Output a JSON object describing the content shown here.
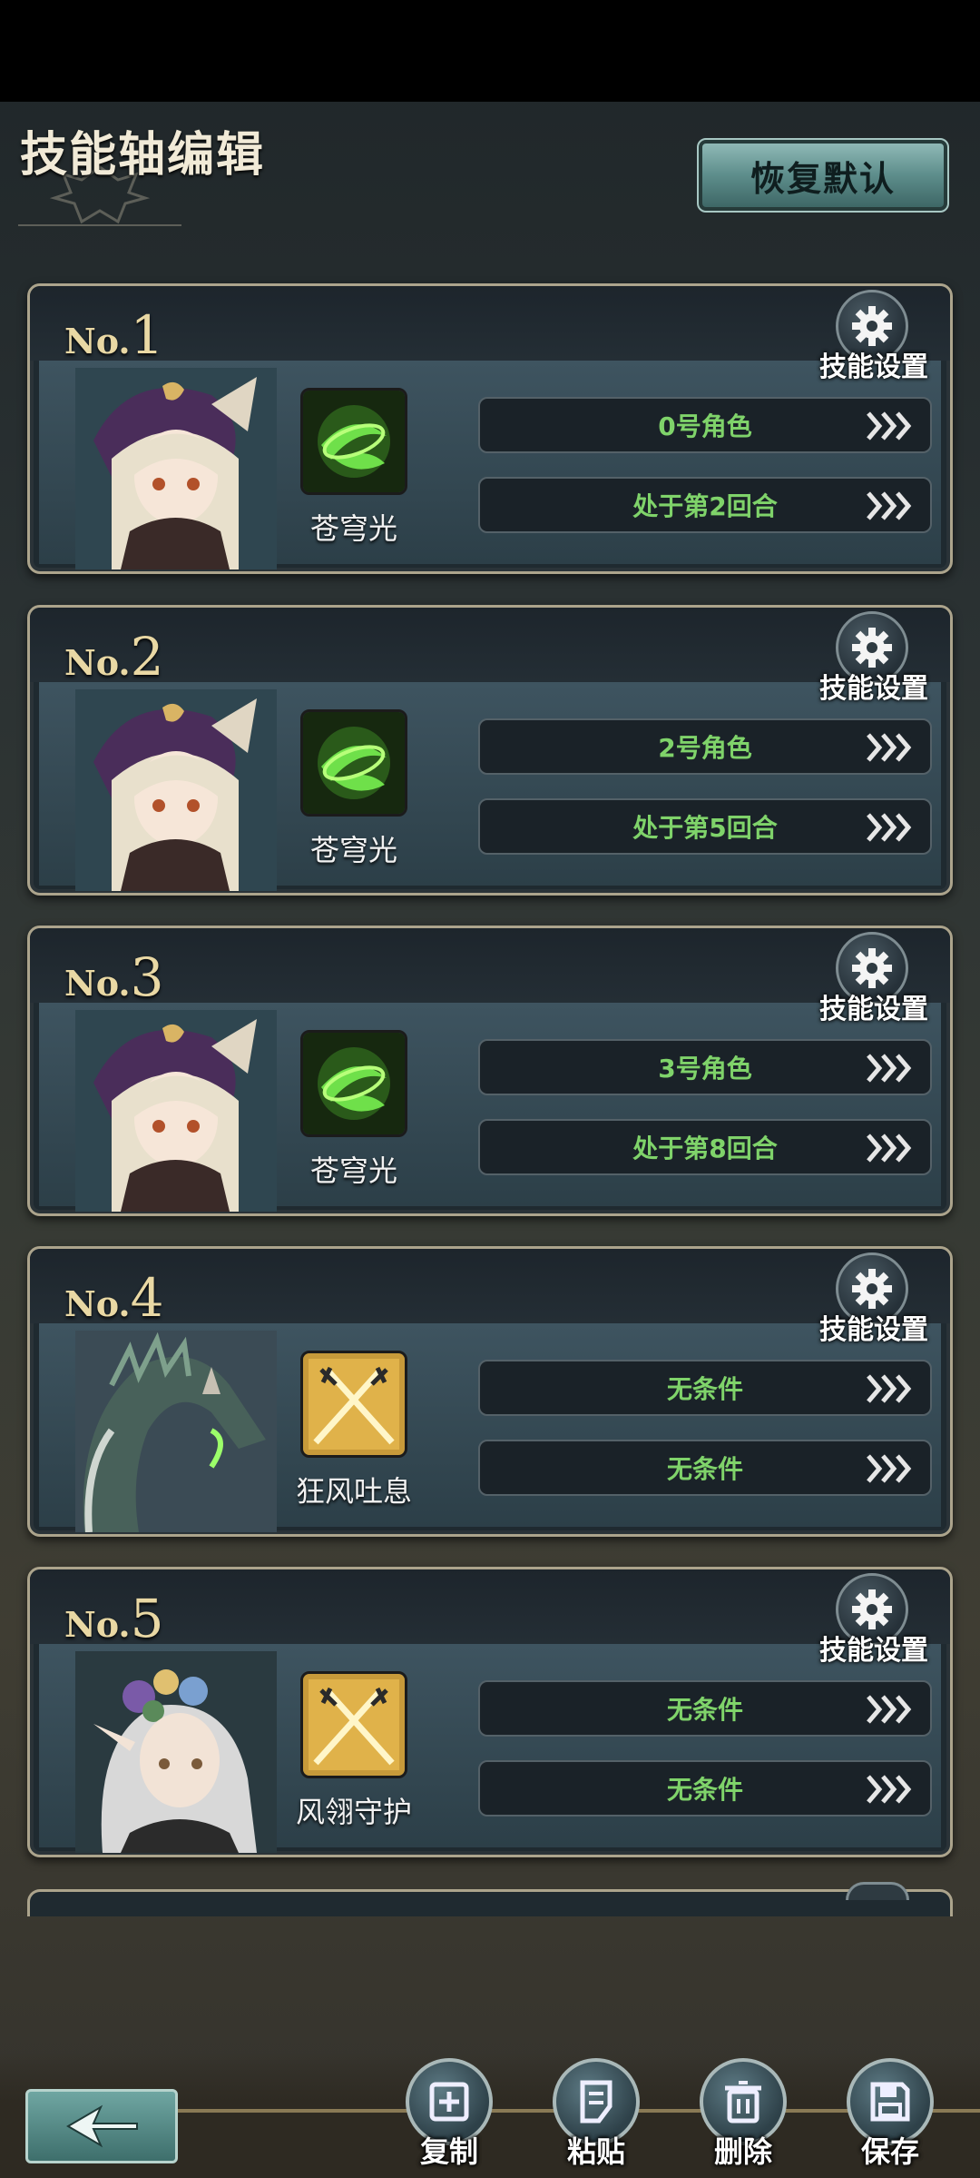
{
  "header": {
    "title": "技能轴编辑",
    "restore_label": "恢复默认"
  },
  "colors": {
    "condition_text": "#7fd36a",
    "number": "#e9d8a4",
    "accent_teal": "#5d8d8b"
  },
  "cards": [
    {
      "prefix": "No.",
      "number": "1",
      "settings_label": "技能设置",
      "skill": "苍穹光",
      "skill_type": "green",
      "portrait": "girl",
      "conditions": [
        "0号角色",
        "处于第2回合"
      ]
    },
    {
      "prefix": "No.",
      "number": "2",
      "settings_label": "技能设置",
      "skill": "苍穹光",
      "skill_type": "green",
      "portrait": "girl",
      "conditions": [
        "2号角色",
        "处于第5回合"
      ]
    },
    {
      "prefix": "No.",
      "number": "3",
      "settings_label": "技能设置",
      "skill": "苍穹光",
      "skill_type": "green",
      "portrait": "girl",
      "conditions": [
        "3号角色",
        "处于第8回合"
      ]
    },
    {
      "prefix": "No.",
      "number": "4",
      "settings_label": "技能设置",
      "skill": "狂风吐息",
      "skill_type": "gold",
      "portrait": "dragon",
      "conditions": [
        "无条件",
        "无条件"
      ]
    },
    {
      "prefix": "No.",
      "number": "5",
      "settings_label": "技能设置",
      "skill": "风翎守护",
      "skill_type": "gold",
      "portrait": "elf",
      "conditions": [
        "无条件",
        "无条件"
      ]
    }
  ],
  "toolbar": {
    "copy": "复制",
    "paste": "粘贴",
    "delete": "删除",
    "save": "保存"
  }
}
